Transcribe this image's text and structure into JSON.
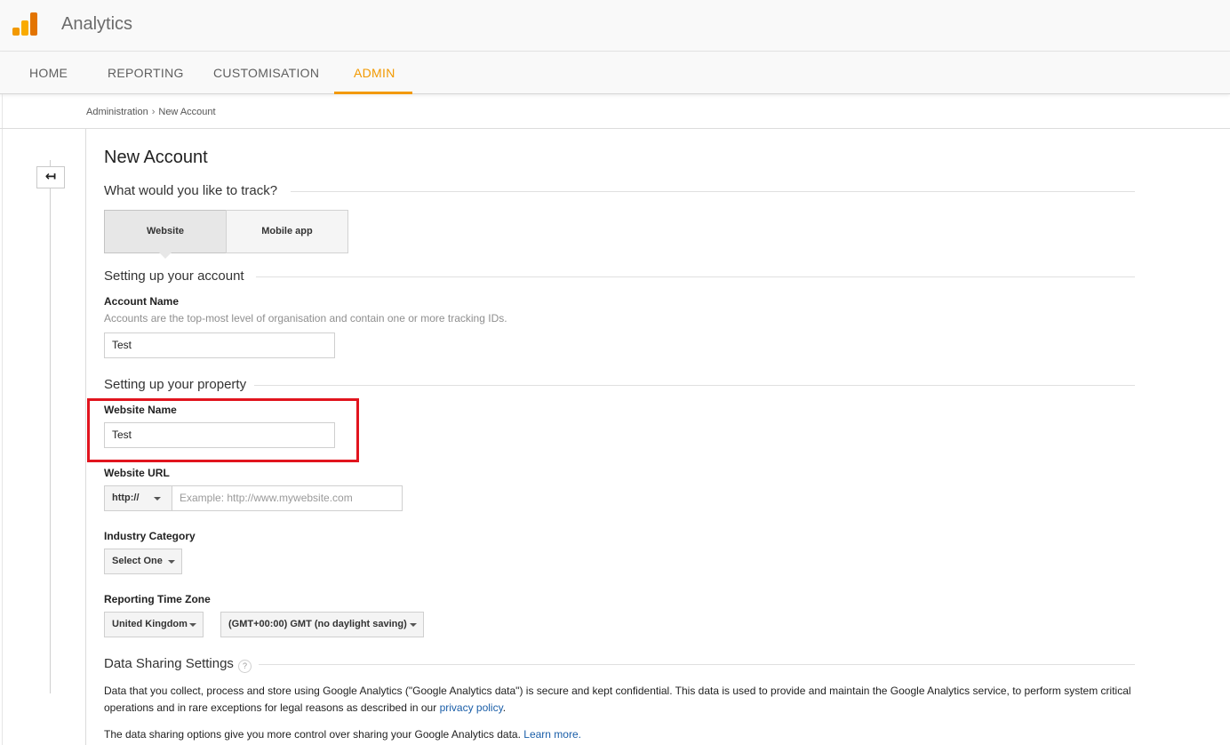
{
  "app": {
    "title": "Analytics"
  },
  "nav": {
    "tabs": [
      {
        "label": "HOME"
      },
      {
        "label": "REPORTING"
      },
      {
        "label": "CUSTOMISATION"
      },
      {
        "label": "ADMIN",
        "active": true
      }
    ]
  },
  "breadcrumb": {
    "items": [
      "Administration",
      "New Account"
    ],
    "separator": "›"
  },
  "page": {
    "title": "New Account"
  },
  "track": {
    "heading": "What would you like to track?",
    "options": [
      "Website",
      "Mobile app"
    ],
    "selected": "Website"
  },
  "account": {
    "heading": "Setting up your account",
    "name_label": "Account Name",
    "name_hint": "Accounts are the top-most level of organisation and contain one or more tracking IDs.",
    "name_value": "Test"
  },
  "property": {
    "heading": "Setting up your property",
    "website_name_label": "Website Name",
    "website_name_value": "Test",
    "website_url_label": "Website URL",
    "protocol_value": "http://",
    "url_placeholder": "Example: http://www.mywebsite.com",
    "industry_label": "Industry Category",
    "industry_value": "Select One",
    "timezone_label": "Reporting Time Zone",
    "country_value": "United Kingdom",
    "timezone_value": "(GMT+00:00) GMT (no daylight saving)"
  },
  "data_sharing": {
    "heading": "Data Sharing Settings",
    "help_glyph": "?",
    "para1_text": "Data that you collect, process and store using Google Analytics (\"Google Analytics data\") is secure and kept confidential. This data is used to provide and maintain the Google Analytics service, to perform system critical operations and in rare exceptions for legal reasons as described in our ",
    "para1_link": "privacy policy",
    "para1_end": ".",
    "para2_text": "The data sharing options give you more control over sharing your Google Analytics data. ",
    "para2_link": "Learn more."
  },
  "colors": {
    "accent": "#f29900",
    "highlight": "#e1141e",
    "link": "#1a5ea8"
  },
  "icons": {
    "logo": "analytics-logo-icon",
    "back": "back-arrow-icon",
    "help": "help-icon",
    "caret": "caret-down-icon"
  }
}
